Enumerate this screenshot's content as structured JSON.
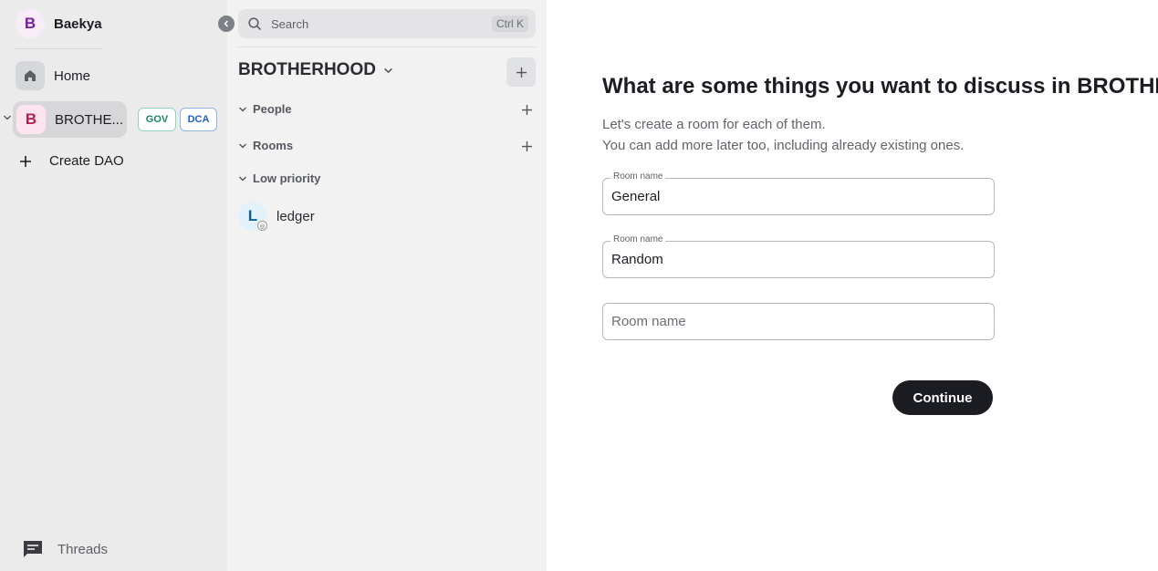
{
  "user": {
    "avatar_letter": "B",
    "name": "Baekya"
  },
  "spaces": {
    "home_label": "Home",
    "dao": {
      "avatar_letter": "B",
      "label": "BROTHE...",
      "badges": [
        "GOV",
        "DCA"
      ]
    },
    "create_label": "Create DAO",
    "threads_label": "Threads"
  },
  "roomlist": {
    "search_placeholder": "Search",
    "search_shortcut": "Ctrl K",
    "space_title": "BROTHERHOOD",
    "sections": {
      "people": "People",
      "rooms": "Rooms",
      "low_priority": "Low priority"
    },
    "room": {
      "avatar_letter": "L",
      "name": "ledger"
    }
  },
  "main": {
    "heading": "What are some things you want to discuss in BROTHERHOOD?",
    "subtext_line1": "Let's create a room for each of them.",
    "subtext_line2": "You can add more later too, including already existing ones.",
    "fields": [
      {
        "label": "Room name",
        "value": "General"
      },
      {
        "label": "Room name",
        "value": "Random"
      },
      {
        "placeholder": "Room name",
        "value": ""
      }
    ],
    "continue_label": "Continue"
  },
  "colors": {
    "accent_dark": "#1b1d22",
    "gov_badge": "#18865c",
    "dca_badge": "#1f5fbf"
  },
  "icons": [
    "search-icon",
    "home-icon",
    "plus-icon",
    "chevron-down-icon",
    "chevron-left-icon",
    "threads-icon"
  ]
}
